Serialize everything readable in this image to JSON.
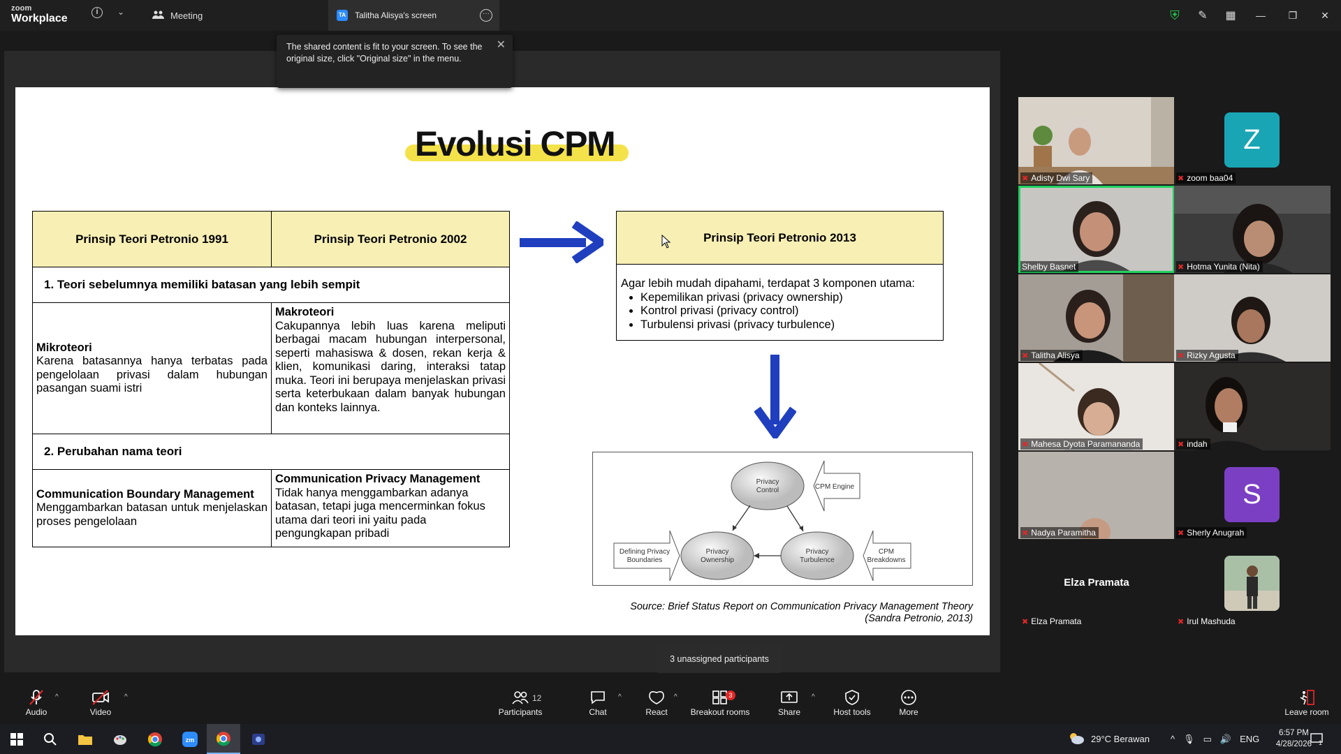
{
  "titlebar": {
    "logo_small": "zoom",
    "logo_big": "Workplace",
    "meeting_label": "Meeting",
    "tab_badge": "TA",
    "tab_label": "Talitha Alisya's screen",
    "more": "···"
  },
  "tooltip": {
    "text": "The shared content is fit to your screen. To see the original size, click \"Original size\" in the menu.",
    "close": "✕"
  },
  "slide": {
    "title": "Evolusi CPM",
    "table": {
      "col1_header": "Prinsip Teori Petronio 1991",
      "col2_header": "Prinsip Teori Petronio 2002",
      "section1": "1. Teori sebelumnya memiliki batasan yang lebih sempit",
      "row1_left_title": "Mikroteori",
      "row1_left_body": "Karena batasannya hanya terbatas pada pengelolaan privasi dalam hubungan pasangan suami istri",
      "row1_right_title": "Makroteori",
      "row1_right_body": "Cakupannya lebih luas karena meliputi berbagai macam hubungan interpersonal, seperti mahasiswa & dosen, rekan kerja & klien, komunikasi daring, interaksi tatap muka. Teori ini berupaya menjelaskan privasi serta keterbukaan dalam banyak hubungan dan konteks lainnya.",
      "section2": "2. Perubahan nama teori",
      "row2_left_title": "Communication Boundary Management",
      "row2_left_body": "Menggambarkan batasan untuk menjelaskan proses pengelolaan",
      "row2_right_title": "Communication Privacy Management",
      "row2_right_body": "Tidak hanya menggambarkan adanya batasan, tetapi juga mencerminkan fokus utama dari teori ini yaitu pada pengungkapan pribadi"
    },
    "box2013": {
      "header": "Prinsip Teori Petronio 2013",
      "intro": "Agar lebih mudah dipahami, terdapat 3 komponen utama:",
      "items": [
        "Kepemilikan privasi (privacy ownership)",
        "Kontrol privasi (privacy control)",
        "Turbulensi privasi (privacy turbulence)"
      ]
    },
    "diagram": {
      "privacy_control_1": "Privacy",
      "privacy_control_2": "Control",
      "cpm_engine": "CPM Engine",
      "defining_1": "Defining Privacy",
      "defining_2": "Boundaries",
      "ownership_1": "Privacy",
      "ownership_2": "Ownership",
      "turbulence_1": "Privacy",
      "turbulence_2": "Turbulence",
      "breakdowns_1": "CPM",
      "breakdowns_2": "Breakdowns"
    },
    "source_line1": "Source: Brief Status Report on Communication Privacy Management Theory",
    "source_line2": "(Sandra Petronio, 2013)"
  },
  "gallery": {
    "participants": [
      {
        "name": "Adisty Dwi Sary"
      },
      {
        "name": "zoom baa04",
        "initial": "Z",
        "color": "#1aa5b5"
      },
      {
        "name": "Shelby Basnet"
      },
      {
        "name": "Hotma Yunita (Nita)"
      },
      {
        "name": "Talitha Alisya"
      },
      {
        "name": "Rizky Agusta"
      },
      {
        "name": "Mahesa Dyota Paramananda"
      },
      {
        "name": "indah"
      },
      {
        "name": "Nadya Paramitha"
      },
      {
        "name": "Sherly Anugrah",
        "initial": "S",
        "color": "#7b3fc4"
      },
      {
        "name": "Elza Pramata",
        "big_name": "Elza Pramata"
      },
      {
        "name": "Irul Mashuda"
      }
    ]
  },
  "unassigned_popup": "3 unassigned participants",
  "toolbar": {
    "audio": "Audio",
    "video": "Video",
    "participants": "Participants",
    "participants_count": "12",
    "chat": "Chat",
    "react": "React",
    "breakout": "Breakout rooms",
    "breakout_badge": "3",
    "share": "Share",
    "host_tools": "Host tools",
    "more": "More",
    "leave": "Leave room"
  },
  "taskbar": {
    "weather": "29°C  Berawan",
    "language": "ENG",
    "time": "6:57 PM",
    "date": "4/28/2026",
    "notif_count": "1"
  },
  "colors": {
    "accent_blue": "#1f3fbf",
    "slide_header_yellow": "#f8efb4",
    "title_highlight": "#f4e24a",
    "active_speaker": "#23d160",
    "mute_red": "#e02828"
  }
}
